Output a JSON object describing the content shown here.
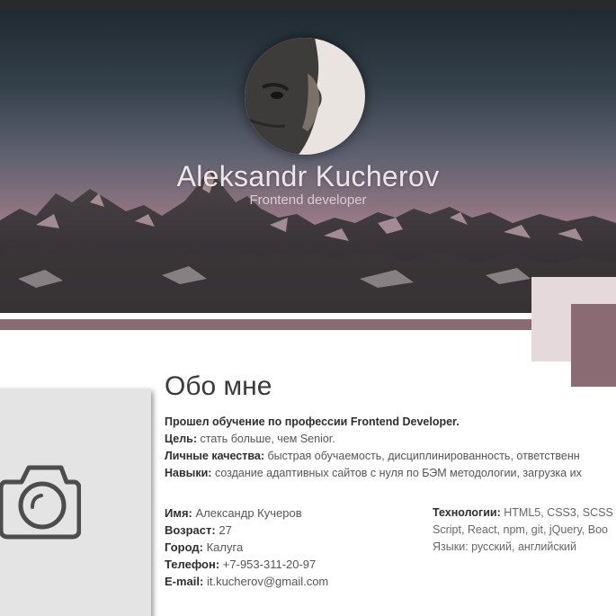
{
  "hero": {
    "name": "Aleksandr Kucherov",
    "role": "Frontend developer"
  },
  "about": {
    "title": "Обо мне",
    "intro": "Прошел обучение по профессии Frontend Developer.",
    "goal_label": "Цель:",
    "goal_value": "стать больше, чем Senior.",
    "qualities_label": "Личные качества:",
    "qualities_value": "быстрая обучаемость, дисциплинированность, ответственн",
    "skills_label": "Навыки:",
    "skills_value": "создание адаптивных сайтов с нуля по БЭМ методологии, загрузка их"
  },
  "info": {
    "name_label": "Имя:",
    "name_value": "Александр Кучеров",
    "age_label": "Возраст:",
    "age_value": "27",
    "city_label": "Город:",
    "city_value": "Калуга",
    "phone_label": "Телефон:",
    "phone_value": "+7-953-311-20-97",
    "email_label": "E-mail:",
    "email_value": "it.kucherov@gmail.com"
  },
  "tech": {
    "label": "Технологии:",
    "line1": "HTML5, CSS3, SCSS",
    "line2": "Script, React, npm, git, jQuery, Boo",
    "languages": "Языки: русский, английский"
  },
  "colors": {
    "accent": "#8a6b74",
    "accent_light": "#e6d9dc",
    "topbar": "#2a2a2c"
  },
  "icons": {
    "photo_placeholder": "camera-icon"
  }
}
